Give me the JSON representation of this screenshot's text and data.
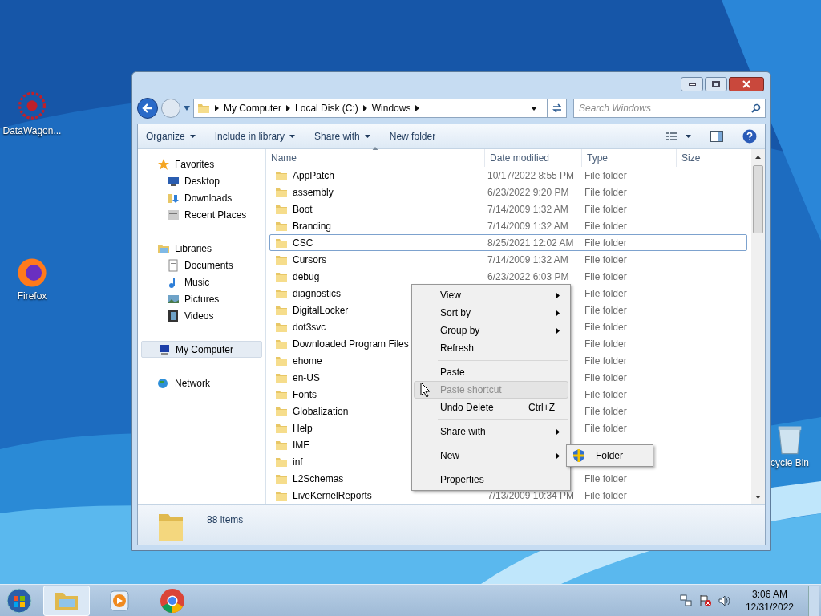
{
  "desktop_icons": [
    {
      "label": "DataWagon...",
      "kind": "datawagon"
    },
    {
      "label": "Firefox",
      "kind": "firefox"
    },
    {
      "label": "cycle Bin",
      "kind": "recycle"
    }
  ],
  "window": {
    "address": {
      "crumbs": [
        "My Computer",
        "Local Disk (C:)",
        "Windows"
      ]
    },
    "search": {
      "placeholder": "Search Windows"
    },
    "toolbar": [
      "Organize",
      "Include in library",
      "Share with",
      "New folder"
    ],
    "toolbar_menus": [
      true,
      true,
      true,
      false
    ],
    "sidebar": [
      {
        "label": "Favorites",
        "kind": "star",
        "selected": false,
        "children": [
          {
            "label": "Desktop",
            "kind": "desktop",
            "selected": false
          },
          {
            "label": "Downloads",
            "kind": "downloads",
            "selected": false
          },
          {
            "label": "Recent Places",
            "kind": "recent",
            "selected": false
          }
        ]
      },
      {
        "label": "Libraries",
        "kind": "libraries",
        "selected": false,
        "children": [
          {
            "label": "Documents",
            "kind": "documents",
            "selected": false
          },
          {
            "label": "Music",
            "kind": "music",
            "selected": false
          },
          {
            "label": "Pictures",
            "kind": "pictures",
            "selected": false
          },
          {
            "label": "Videos",
            "kind": "videos",
            "selected": false
          }
        ]
      },
      {
        "label": "My Computer",
        "kind": "computer",
        "selected": true
      },
      {
        "label": "Network",
        "kind": "network",
        "selected": false
      }
    ],
    "columns": [
      {
        "label": "Name",
        "sorted": true
      },
      {
        "label": "Date modified",
        "sorted": false
      },
      {
        "label": "Type",
        "sorted": false
      },
      {
        "label": "Size",
        "sorted": false
      }
    ],
    "rows": [
      {
        "name": "AppPatch",
        "date": "10/17/2022 8:55 PM",
        "type": "File folder",
        "focused": false
      },
      {
        "name": "assembly",
        "date": "6/23/2022 9:20 PM",
        "type": "File folder",
        "focused": false
      },
      {
        "name": "Boot",
        "date": "7/14/2009 1:32 AM",
        "type": "File folder",
        "focused": false
      },
      {
        "name": "Branding",
        "date": "7/14/2009 1:32 AM",
        "type": "File folder",
        "focused": false
      },
      {
        "name": "CSC",
        "date": "8/25/2021 12:02 AM",
        "type": "File folder",
        "focused": true
      },
      {
        "name": "Cursors",
        "date": "7/14/2009 1:32 AM",
        "type": "File folder",
        "focused": false
      },
      {
        "name": "debug",
        "date": "6/23/2022 6:03 PM",
        "type": "File folder",
        "focused": false
      },
      {
        "name": "diagnostics",
        "type": "File folder",
        "focused": false
      },
      {
        "name": "DigitalLocker",
        "type": "File folder",
        "focused": false
      },
      {
        "name": "dot3svc",
        "type": "File folder",
        "focused": false
      },
      {
        "name": "Downloaded Program Files",
        "type": "File folder",
        "focused": false
      },
      {
        "name": "ehome",
        "type": "File folder",
        "focused": false
      },
      {
        "name": "en-US",
        "type": "File folder",
        "focused": false
      },
      {
        "name": "Fonts",
        "type": "File folder",
        "focused": false
      },
      {
        "name": "Globalization",
        "type": "File folder",
        "focused": false
      },
      {
        "name": "Help",
        "type": "File folder",
        "focused": false
      },
      {
        "name": "IME",
        "focused": false
      },
      {
        "name": "inf",
        "focused": false
      },
      {
        "name": "L2Schemas",
        "type": "File folder",
        "focused": false
      },
      {
        "name": "LiveKernelReports",
        "date": "7/13/2009 10:34 PM",
        "type": "File folder",
        "focused": false
      }
    ],
    "status": "88 items"
  },
  "context_menu": [
    {
      "kind": "item",
      "label": "View",
      "submenu": true,
      "disabled": false,
      "selected": false
    },
    {
      "kind": "item",
      "label": "Sort by",
      "submenu": true,
      "disabled": false,
      "selected": false
    },
    {
      "kind": "item",
      "label": "Group by",
      "submenu": true,
      "disabled": false,
      "selected": false
    },
    {
      "kind": "item",
      "label": "Refresh",
      "submenu": false,
      "disabled": false,
      "selected": false
    },
    {
      "kind": "separator"
    },
    {
      "kind": "item",
      "label": "Paste",
      "submenu": false,
      "disabled": false,
      "selected": false
    },
    {
      "kind": "item",
      "label": "Paste shortcut",
      "submenu": false,
      "disabled": true,
      "selected": true
    },
    {
      "kind": "item",
      "label": "Undo Delete",
      "shortcut": "Ctrl+Z",
      "submenu": false,
      "disabled": false,
      "selected": false
    },
    {
      "kind": "separator"
    },
    {
      "kind": "item",
      "label": "Share with",
      "submenu": true,
      "disabled": false,
      "selected": false
    },
    {
      "kind": "separator"
    },
    {
      "kind": "item",
      "label": "New",
      "submenu": true,
      "disabled": false,
      "selected": false
    },
    {
      "kind": "separator"
    },
    {
      "kind": "item",
      "label": "Properties",
      "submenu": false,
      "disabled": false,
      "selected": false
    }
  ],
  "submenu": [
    {
      "label": "Folder"
    }
  ],
  "taskbar": {
    "apps": [
      {
        "kind": "explorer",
        "selected": true
      },
      {
        "kind": "media",
        "selected": false
      },
      {
        "kind": "chrome",
        "selected": false
      }
    ],
    "time": "3:06 AM",
    "date": "12/31/2022"
  }
}
